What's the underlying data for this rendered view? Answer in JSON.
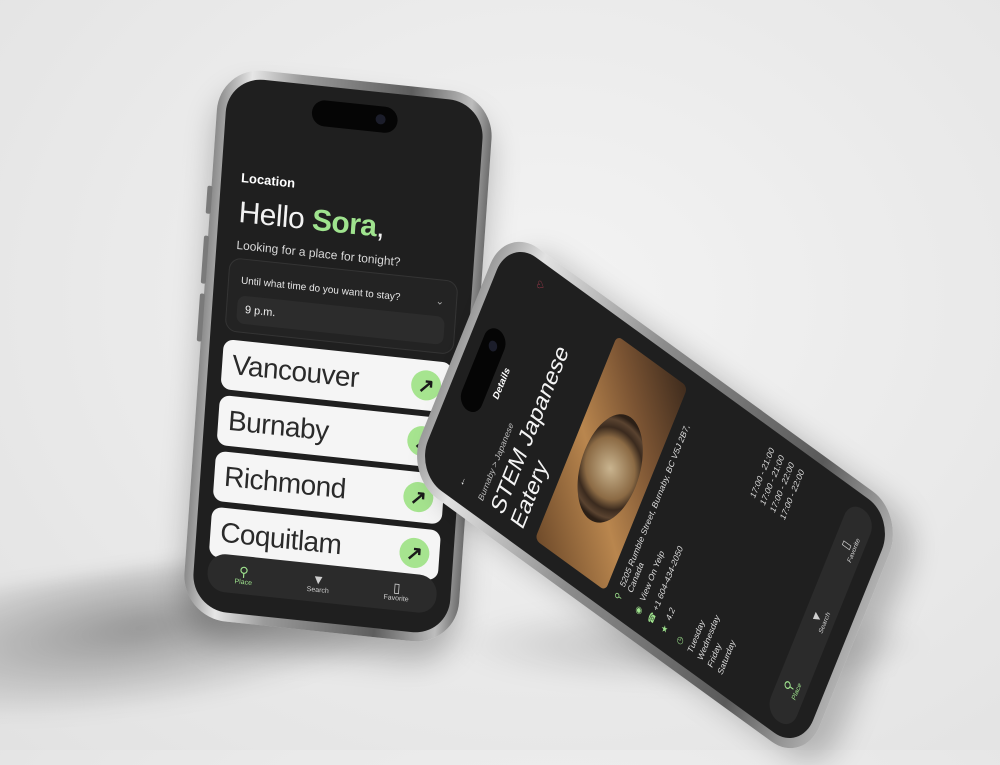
{
  "phone1": {
    "header": "Location",
    "greeting_prefix": "Hello ",
    "greeting_name": "Sora",
    "greeting_suffix": ",",
    "subtitle": "Looking for a place for tonight?",
    "stay_question": "Until what time do you want to stay?",
    "stay_value": "9 p.m.",
    "cities": [
      {
        "label": "Vancouver"
      },
      {
        "label": "Burnaby"
      },
      {
        "label": "Richmond"
      },
      {
        "label": "Coquitlam"
      }
    ],
    "tabs": [
      {
        "label": "Place",
        "icon": "pin-icon",
        "active": true
      },
      {
        "label": "Search",
        "icon": "filter-icon",
        "active": false
      },
      {
        "label": "Favorite",
        "icon": "bookmark-icon",
        "active": false
      }
    ],
    "accent": "#9fe38e"
  },
  "phone2": {
    "top_title": "Details",
    "breadcrumb": "Burnaby > Japanese",
    "restaurant_name": "STEM Japanese Eatery",
    "address": "5205 Rumble Street, Burnaby, BC V5J 2B7, Canada",
    "yelp": "View On Yelp",
    "phone": "+1 604-434-2050",
    "rating": "4.2",
    "hours": [
      {
        "day": "Tuesday",
        "time": "17:00 - 21:00"
      },
      {
        "day": "Wednesday",
        "time": "17:00 - 21:00"
      },
      {
        "day": "Friday",
        "time": "17:00 - 22:00"
      },
      {
        "day": "Saturday",
        "time": "17:00 - 22:00"
      }
    ],
    "tabs": [
      {
        "label": "Place",
        "icon": "pin-icon"
      },
      {
        "label": "Search",
        "icon": "filter-icon"
      },
      {
        "label": "Favorite",
        "icon": "bookmark-icon"
      }
    ],
    "heart_color": "#ff4d6d"
  }
}
